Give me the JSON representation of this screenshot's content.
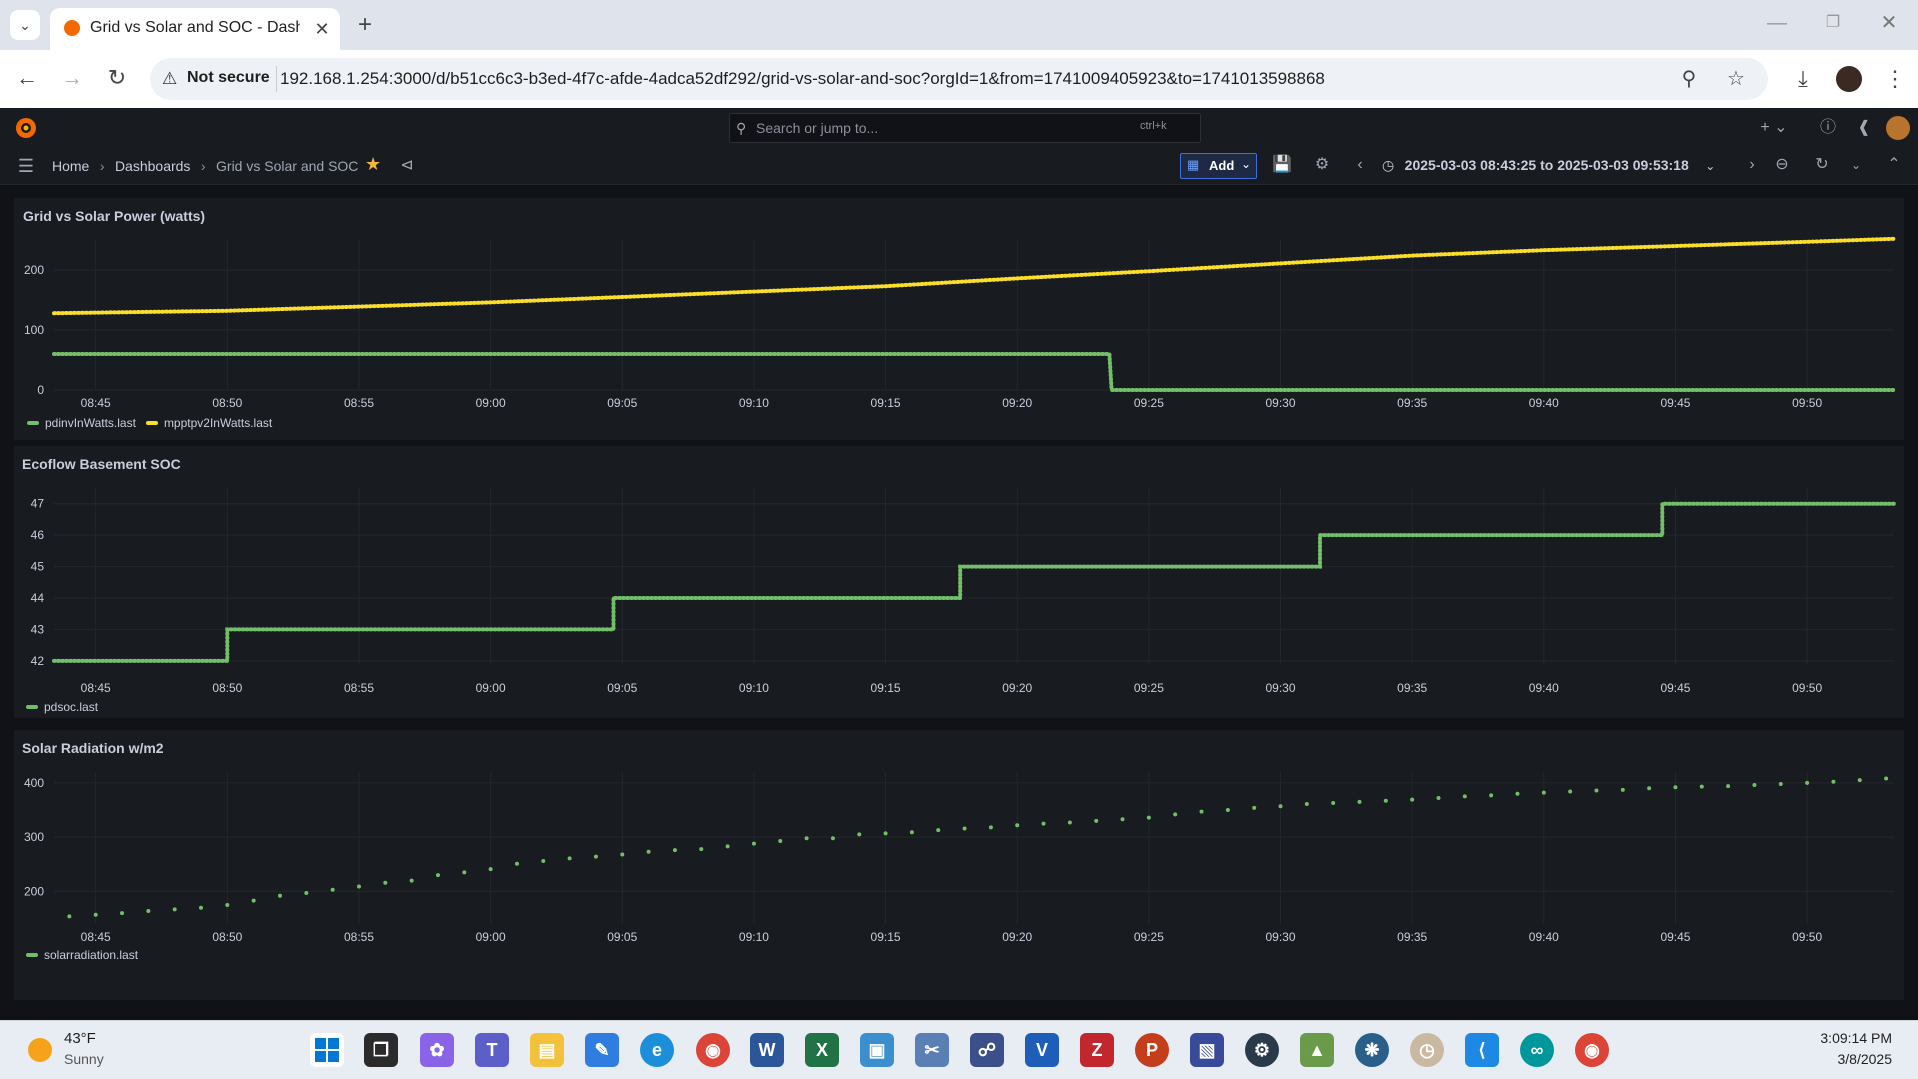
{
  "browser": {
    "tab_title": "Grid vs Solar and SOC - Dashbo",
    "security_label": "Not secure",
    "url": "192.168.1.254:3000/d/b51cc6c3-b3ed-4f7c-afde-4adca52df292/grid-vs-solar-and-soc?orgId=1&from=1741009405923&to=1741013598868"
  },
  "grafana": {
    "search_placeholder": "Search or jump to...",
    "search_shortcut": "ctrl+k",
    "breadcrumb": [
      "Home",
      "Dashboards",
      "Grid vs Solar and SOC"
    ],
    "add_label": "Add",
    "time_range": "2025-03-03 08:43:25 to 2025-03-03 09:53:18"
  },
  "panels": [
    {
      "title": "Grid vs Solar Power (watts)"
    },
    {
      "title": "Ecoflow Basement SOC"
    },
    {
      "title": "Solar Radiation w/m2"
    }
  ],
  "chart_data": [
    {
      "type": "line",
      "title": "Grid vs Solar Power (watts)",
      "x_ticks": [
        "08:45",
        "08:50",
        "08:55",
        "09:00",
        "09:05",
        "09:10",
        "09:15",
        "09:20",
        "09:25",
        "09:30",
        "09:35",
        "09:40",
        "09:45",
        "09:50"
      ],
      "y_ticks": [
        0,
        100,
        200
      ],
      "ylim": [
        0,
        250
      ],
      "xlim": [
        "08:43:25",
        "09:53:18"
      ],
      "grid": true,
      "legend_position": "bottom-left",
      "series": [
        {
          "name": "pdinvInWatts.last",
          "color": "#73bf69",
          "points": [
            [
              "08:43:25",
              60
            ],
            [
              "09:23:30",
              60
            ],
            [
              "09:23:35",
              0
            ],
            [
              "09:53:18",
              0
            ]
          ]
        },
        {
          "name": "mpptpv2InWatts.last",
          "color": "#fade2a",
          "points": [
            [
              "08:43:25",
              128
            ],
            [
              "08:50",
              132
            ],
            [
              "09:00",
              146
            ],
            [
              "09:05",
              155
            ],
            [
              "09:10",
              164
            ],
            [
              "09:15",
              173
            ],
            [
              "09:20",
              186
            ],
            [
              "09:25",
              198
            ],
            [
              "09:30",
              211
            ],
            [
              "09:35",
              224
            ],
            [
              "09:40",
              233
            ],
            [
              "09:45",
              240
            ],
            [
              "09:50",
              247
            ],
            [
              "09:53:18",
              252
            ]
          ]
        }
      ]
    },
    {
      "type": "line",
      "title": "Ecoflow Basement SOC",
      "x_ticks": [
        "08:45",
        "08:50",
        "08:55",
        "09:00",
        "09:05",
        "09:10",
        "09:15",
        "09:20",
        "09:25",
        "09:30",
        "09:35",
        "09:40",
        "09:45",
        "09:50"
      ],
      "y_ticks": [
        42,
        43,
        44,
        45,
        46,
        47
      ],
      "ylim": [
        41.9,
        47.5
      ],
      "xlim": [
        "08:43:25",
        "09:53:18"
      ],
      "grid": true,
      "legend_position": "bottom-left",
      "series": [
        {
          "name": "pdsoc.last",
          "color": "#73bf69",
          "points": [
            [
              "08:43:25",
              42
            ],
            [
              "08:50:00",
              42
            ],
            [
              "08:50:00",
              43
            ],
            [
              "09:04:40",
              43
            ],
            [
              "09:04:40",
              44
            ],
            [
              "09:17:50",
              44
            ],
            [
              "09:17:50",
              45
            ],
            [
              "09:31:30",
              45
            ],
            [
              "09:31:30",
              46
            ],
            [
              "09:44:30",
              46
            ],
            [
              "09:44:30",
              47
            ],
            [
              "09:53:18",
              47
            ]
          ]
        }
      ]
    },
    {
      "type": "scatter",
      "title": "Solar Radiation w/m2",
      "x_ticks": [
        "08:45",
        "08:50",
        "08:55",
        "09:00",
        "09:05",
        "09:10",
        "09:15",
        "09:20",
        "09:25",
        "09:30",
        "09:35",
        "09:40",
        "09:45",
        "09:50"
      ],
      "y_ticks": [
        200,
        300,
        400
      ],
      "ylim": [
        140,
        420
      ],
      "xlim": [
        "08:43:25",
        "09:53:18"
      ],
      "grid": true,
      "legend_position": "bottom-left",
      "series": [
        {
          "name": "solarradiation.last",
          "color": "#73bf69",
          "points": [
            [
              "08:44",
              154
            ],
            [
              "08:45",
              157
            ],
            [
              "08:46",
              160
            ],
            [
              "08:47",
              164
            ],
            [
              "08:48",
              167
            ],
            [
              "08:49",
              170
            ],
            [
              "08:50",
              175
            ],
            [
              "08:51",
              183
            ],
            [
              "08:52",
              192
            ],
            [
              "08:53",
              197
            ],
            [
              "08:54",
              203
            ],
            [
              "08:55",
              209
            ],
            [
              "08:56",
              216
            ],
            [
              "08:57",
              220
            ],
            [
              "08:58",
              230
            ],
            [
              "08:59",
              235
            ],
            [
              "09:00",
              241
            ],
            [
              "09:01",
              251
            ],
            [
              "09:02",
              256
            ],
            [
              "09:03",
              261
            ],
            [
              "09:04",
              264
            ],
            [
              "09:05",
              268
            ],
            [
              "09:06",
              273
            ],
            [
              "09:07",
              276
            ],
            [
              "09:08",
              278
            ],
            [
              "09:09",
              283
            ],
            [
              "09:10",
              288
            ],
            [
              "09:11",
              293
            ],
            [
              "09:12",
              298
            ],
            [
              "09:13",
              298
            ],
            [
              "09:14",
              305
            ],
            [
              "09:15",
              307
            ],
            [
              "09:16",
              309
            ],
            [
              "09:17",
              313
            ],
            [
              "09:18",
              316
            ],
            [
              "09:19",
              318
            ],
            [
              "09:20",
              322
            ],
            [
              "09:21",
              325
            ],
            [
              "09:22",
              327
            ],
            [
              "09:23",
              330
            ],
            [
              "09:24",
              333
            ],
            [
              "09:25",
              336
            ],
            [
              "09:26",
              342
            ],
            [
              "09:27",
              347
            ],
            [
              "09:28",
              350
            ],
            [
              "09:29",
              354
            ],
            [
              "09:30",
              357
            ],
            [
              "09:31",
              361
            ],
            [
              "09:32",
              363
            ],
            [
              "09:33",
              365
            ],
            [
              "09:34",
              367
            ],
            [
              "09:35",
              369
            ],
            [
              "09:36",
              372
            ],
            [
              "09:37",
              375
            ],
            [
              "09:38",
              377
            ],
            [
              "09:39",
              380
            ],
            [
              "09:40",
              382
            ],
            [
              "09:41",
              384
            ],
            [
              "09:42",
              386
            ],
            [
              "09:43",
              387
            ],
            [
              "09:44",
              390
            ],
            [
              "09:45",
              392
            ],
            [
              "09:46",
              393
            ],
            [
              "09:47",
              394
            ],
            [
              "09:48",
              396
            ],
            [
              "09:49",
              398
            ],
            [
              "09:50",
              400
            ],
            [
              "09:51",
              402
            ],
            [
              "09:52",
              405
            ],
            [
              "09:53",
              408
            ]
          ]
        }
      ]
    }
  ],
  "taskbar": {
    "weather_temp": "43°F",
    "weather_cond": "Sunny",
    "time": "3:09:14 PM",
    "date": "3/8/2025"
  }
}
